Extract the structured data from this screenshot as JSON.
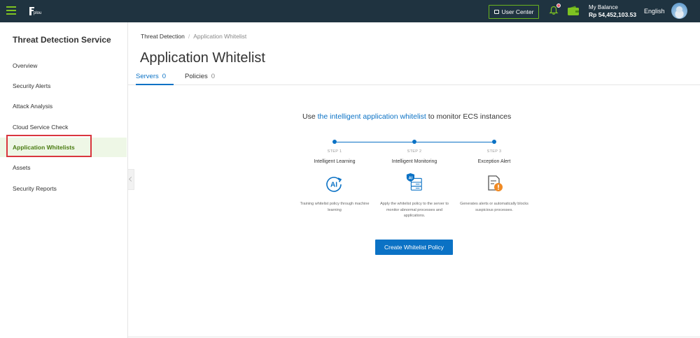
{
  "topbar": {
    "logo_text": "plou",
    "user_center_label": "User Center",
    "balance_label": "My Balance",
    "balance_value": "Rp 54,452,103.53",
    "language": "English",
    "icons": [
      "menu-icon",
      "logo-icon",
      "monitor-icon",
      "bell-icon",
      "wallet-icon",
      "avatar"
    ],
    "accent": "#6ab41e",
    "bg": "#1f3340"
  },
  "sidebar": {
    "title": "Threat Detection Service",
    "items": [
      {
        "label": "Overview"
      },
      {
        "label": "Security Alerts"
      },
      {
        "label": "Attack Analysis"
      },
      {
        "label": "Cloud Service Check"
      },
      {
        "label": "Application Whitelists",
        "active": true
      },
      {
        "label": "Assets"
      },
      {
        "label": "Security Reports"
      }
    ],
    "active_color": "#4a7c12"
  },
  "breadcrumb": {
    "root": "Threat Detection",
    "separator": "/",
    "current": "Application Whitelist"
  },
  "page": {
    "title": "Application Whitelist",
    "tabs": [
      {
        "label": "Servers",
        "count": "0",
        "active": true
      },
      {
        "label": "Policies",
        "count": "0",
        "active": false
      }
    ]
  },
  "intro": {
    "prefix": "Use ",
    "link": "the intelligent application whitelist",
    "suffix": " to monitor ECS instances"
  },
  "steps": [
    {
      "num": "STEP 1",
      "name": "Intelligent Learning",
      "desc": "Training whitelist policy through machine learning",
      "icon": "ai-learning-icon"
    },
    {
      "num": "STEP 2",
      "name": "Intelligent Monitoring",
      "desc": "Apply the whitelist policy to the server to monitor abnormal processes and applications.",
      "icon": "ai-server-icon"
    },
    {
      "num": "STEP 3",
      "name": "Exception Alert",
      "desc": "Generates alerts or automatically blocks suspicious processes.",
      "icon": "document-alert-icon"
    }
  ],
  "cta": {
    "label": "Create Whitelist Policy"
  },
  "colors": {
    "primary": "#0b72c5",
    "alert_orange": "#f08a24"
  }
}
